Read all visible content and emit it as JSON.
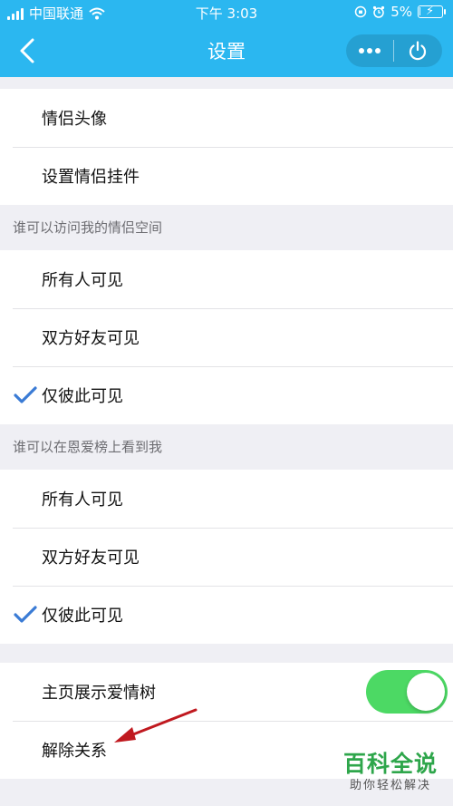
{
  "status_bar": {
    "carrier": "中国联通",
    "time": "下午 3:03",
    "battery": "5%"
  },
  "nav": {
    "title": "设置",
    "back_icon": "chevron-left-icon",
    "more_icon": "more-dots-icon",
    "close_icon": "power-icon"
  },
  "top_rows": [
    "情侣头像",
    "设置情侣挂件"
  ],
  "access_section": {
    "label": "谁可以访问我的情侣空间",
    "options": [
      "所有人可见",
      "双方好友可见",
      "仅彼此可见"
    ],
    "selected": "仅彼此可见"
  },
  "ranking_section": {
    "label": "谁可以在恩爱榜上看到我",
    "options": [
      "所有人可见",
      "双方好友可见",
      "仅彼此可见"
    ],
    "selected": "仅彼此可见"
  },
  "bottom_rows": {
    "love_tree_label": "主页展示爱情树",
    "love_tree_on": true,
    "unbind_label": "解除关系"
  },
  "colors": {
    "header": "#2bb7f0",
    "toggle_on": "#4cd964",
    "check": "#3a7bd5",
    "arrow": "#c0191f"
  },
  "watermark": {
    "main": "百科全说",
    "sub": "助你轻松解决"
  }
}
